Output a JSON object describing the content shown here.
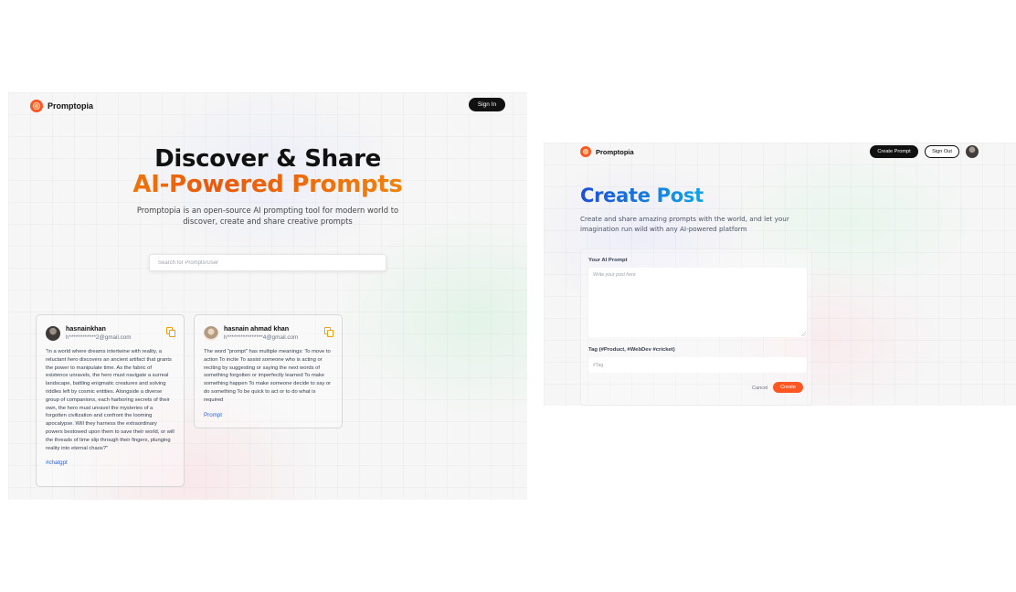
{
  "left_screen": {
    "nav": {
      "logo_text": "Promptopia",
      "sign_in_label": "Sign In"
    },
    "hero": {
      "title_line1": "Discover & Share",
      "title_line2": "AI-Powered Prompts",
      "description": "Promptopia is an open-source AI prompting tool for modern world to discover, create and share creative prompts"
    },
    "search": {
      "placeholder": "Search for Prompts/User",
      "value": ""
    },
    "cards": [
      {
        "username": "hasnainkhan",
        "email": "h************2@gmail.com",
        "text": "\"In a world where dreams intertwine with reality, a reluctant hero discovers an ancient artifact that grants the power to manipulate time. As the fabric of existence unravels, the hero must navigate a surreal landscape, battling enigmatic creatures and solving riddles left by cosmic entities. Alongside a diverse group of companions, each harboring secrets of their own, the hero must unravel the mysteries of a forgotten civilization and confront the looming apocalypse. Will they harness the extraordinary powers bestowed upon them to save their world, or will the threads of time slip through their fingers, plunging reality into eternal chaos?\"",
        "tag": "#chatgpt"
      },
      {
        "username": "hasnain ahmad khan",
        "email": "h****************4@gmail.com",
        "text": "The word \"prompt\" has multiple meanings: To move to action To incite To assist someone who is acting or reciting by suggesting or saying the next words of something forgotten or imperfectly learned To make something happen To make someone decide to say or do something To be quick to act or to do what is required",
        "tag": "Prompt"
      }
    ]
  },
  "right_screen": {
    "nav": {
      "logo_text": "Promptopia",
      "create_prompt_label": "Create Prompt",
      "sign_out_label": "Sign Out"
    },
    "title": "Create Post",
    "description": "Create and share amazing prompts with the world, and let your imagination run wild with any AI-powered platform",
    "form": {
      "prompt_label": "Your AI Prompt",
      "prompt_placeholder": "Write your post here",
      "prompt_value": "",
      "tag_label": "Tag (#Product, #WebDev #cricket)",
      "tag_placeholder": "#Tag",
      "tag_value": "",
      "cancel_label": "Cancel",
      "submit_label": "Create"
    }
  },
  "colors": {
    "accent_orange": "#ff5722",
    "heading_orange": "#ea580c",
    "heading_blue": "#1d4ed8",
    "tag_blue": "#2563eb",
    "button_black": "#111111"
  }
}
